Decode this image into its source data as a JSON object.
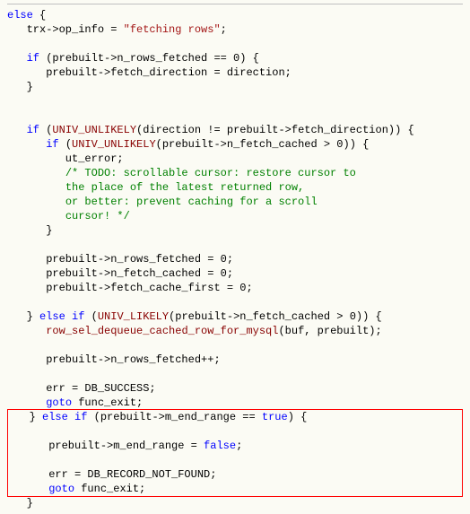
{
  "lines": [
    {
      "i": "",
      "pre": "",
      "c": [
        {
          "cls": "kw",
          "t": "else"
        },
        {
          "cls": "",
          "t": " {"
        }
      ]
    },
    {
      "i": "   ",
      "c": [
        {
          "cls": "",
          "t": "trx->op_info = "
        },
        {
          "cls": "str",
          "t": "\"fetching rows\""
        },
        {
          "cls": "",
          "t": ";"
        }
      ]
    },
    {
      "blank": true
    },
    {
      "i": "   ",
      "c": [
        {
          "cls": "kw",
          "t": "if"
        },
        {
          "cls": "",
          "t": " (prebuilt->n_rows_fetched == 0) {"
        }
      ]
    },
    {
      "i": "      ",
      "c": [
        {
          "cls": "",
          "t": "prebuilt->fetch_direction = direction;"
        }
      ]
    },
    {
      "i": "   ",
      "c": [
        {
          "cls": "",
          "t": "}"
        }
      ]
    },
    {
      "blank": true
    },
    {
      "blank": true
    },
    {
      "i": "   ",
      "c": [
        {
          "cls": "kw",
          "t": "if"
        },
        {
          "cls": "",
          "t": " ("
        },
        {
          "cls": "fn",
          "t": "UNIV_UNLIKELY"
        },
        {
          "cls": "",
          "t": "(direction != prebuilt->fetch_direction)) {"
        }
      ]
    },
    {
      "i": "      ",
      "c": [
        {
          "cls": "kw",
          "t": "if"
        },
        {
          "cls": "",
          "t": " ("
        },
        {
          "cls": "fn",
          "t": "UNIV_UNLIKELY"
        },
        {
          "cls": "",
          "t": "(prebuilt->n_fetch_cached > 0)) {"
        }
      ]
    },
    {
      "i": "         ",
      "c": [
        {
          "cls": "",
          "t": "ut_error;"
        }
      ]
    },
    {
      "i": "         ",
      "c": [
        {
          "cls": "cmt",
          "t": "/* TODO: scrollable cursor: restore cursor to"
        }
      ]
    },
    {
      "i": "         ",
      "c": [
        {
          "cls": "cmt",
          "t": "the place of the latest returned row,"
        }
      ]
    },
    {
      "i": "         ",
      "c": [
        {
          "cls": "cmt",
          "t": "or better: prevent caching for a scroll"
        }
      ]
    },
    {
      "i": "         ",
      "c": [
        {
          "cls": "cmt",
          "t": "cursor! */"
        }
      ]
    },
    {
      "i": "      ",
      "c": [
        {
          "cls": "",
          "t": "}"
        }
      ]
    },
    {
      "blank": true
    },
    {
      "i": "      ",
      "c": [
        {
          "cls": "",
          "t": "prebuilt->n_rows_fetched = 0;"
        }
      ]
    },
    {
      "i": "      ",
      "c": [
        {
          "cls": "",
          "t": "prebuilt->n_fetch_cached = 0;"
        }
      ]
    },
    {
      "i": "      ",
      "c": [
        {
          "cls": "",
          "t": "prebuilt->fetch_cache_first = 0;"
        }
      ]
    },
    {
      "blank": true
    },
    {
      "i": "   ",
      "c": [
        {
          "cls": "",
          "t": "} "
        },
        {
          "cls": "kw",
          "t": "else if"
        },
        {
          "cls": "",
          "t": " ("
        },
        {
          "cls": "fn",
          "t": "UNIV_LIKELY"
        },
        {
          "cls": "",
          "t": "(prebuilt->n_fetch_cached > 0)) {"
        }
      ]
    },
    {
      "i": "      ",
      "c": [
        {
          "cls": "fn",
          "t": "row_sel_dequeue_cached_row_for_mysql"
        },
        {
          "cls": "",
          "t": "(buf, prebuilt);"
        }
      ]
    },
    {
      "blank": true
    },
    {
      "i": "      ",
      "c": [
        {
          "cls": "",
          "t": "prebuilt->n_rows_fetched++;"
        }
      ]
    },
    {
      "blank": true
    },
    {
      "i": "      ",
      "c": [
        {
          "cls": "",
          "t": "err = DB_SUCCESS;"
        }
      ]
    },
    {
      "i": "      ",
      "c": [
        {
          "cls": "kw",
          "t": "goto"
        },
        {
          "cls": "",
          "t": " func_exit;"
        }
      ]
    }
  ],
  "highlight": [
    {
      "i": "   ",
      "c": [
        {
          "cls": "",
          "t": "} "
        },
        {
          "cls": "kw",
          "t": "else if"
        },
        {
          "cls": "",
          "t": " (prebuilt->m_end_range == "
        },
        {
          "cls": "kwtrue",
          "t": "true"
        },
        {
          "cls": "",
          "t": ") {"
        }
      ]
    },
    {
      "blank": true
    },
    {
      "i": "      ",
      "c": [
        {
          "cls": "",
          "t": "prebuilt->m_end_range = "
        },
        {
          "cls": "kwtrue",
          "t": "false"
        },
        {
          "cls": "",
          "t": ";"
        }
      ]
    },
    {
      "blank": true
    },
    {
      "i": "      ",
      "c": [
        {
          "cls": "",
          "t": "err = DB_RECORD_NOT_FOUND;"
        }
      ]
    },
    {
      "i": "      ",
      "c": [
        {
          "cls": "kw",
          "t": "goto"
        },
        {
          "cls": "",
          "t": " func_exit;"
        }
      ]
    }
  ],
  "after": [
    {
      "i": "   ",
      "c": [
        {
          "cls": "",
          "t": "}"
        }
      ]
    }
  ]
}
